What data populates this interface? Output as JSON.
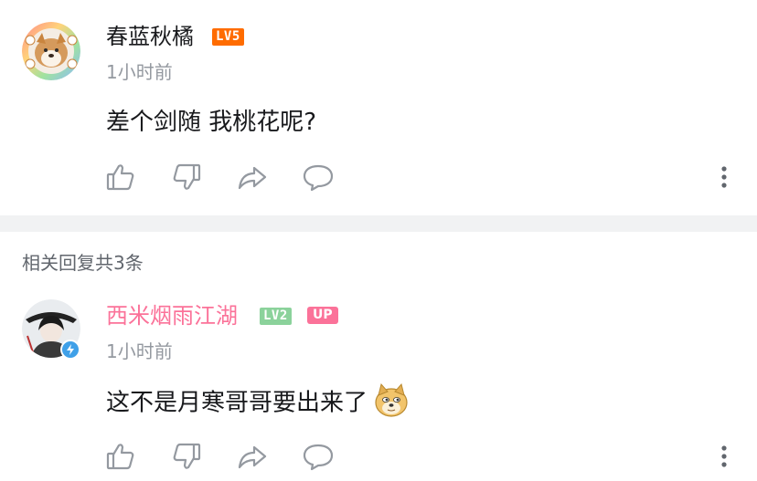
{
  "comment": {
    "username": "春蓝秋橘",
    "level": "LV5",
    "time": "1小时前",
    "content": "差个剑随 我桃花呢?",
    "level_color": "#ff6c00"
  },
  "replies_header": "相关回复共3条",
  "reply": {
    "username": "西米烟雨江湖",
    "level": "LV2",
    "up_badge": "UP",
    "time": "1小时前",
    "content": "这不是月寒哥哥要出来了",
    "username_color": "#fb7299",
    "level_color": "#8bd29b",
    "emoji": "doge-emoji"
  },
  "actions": [
    "like-icon",
    "dislike-icon",
    "share-icon",
    "reply-icon",
    "more-icon"
  ]
}
